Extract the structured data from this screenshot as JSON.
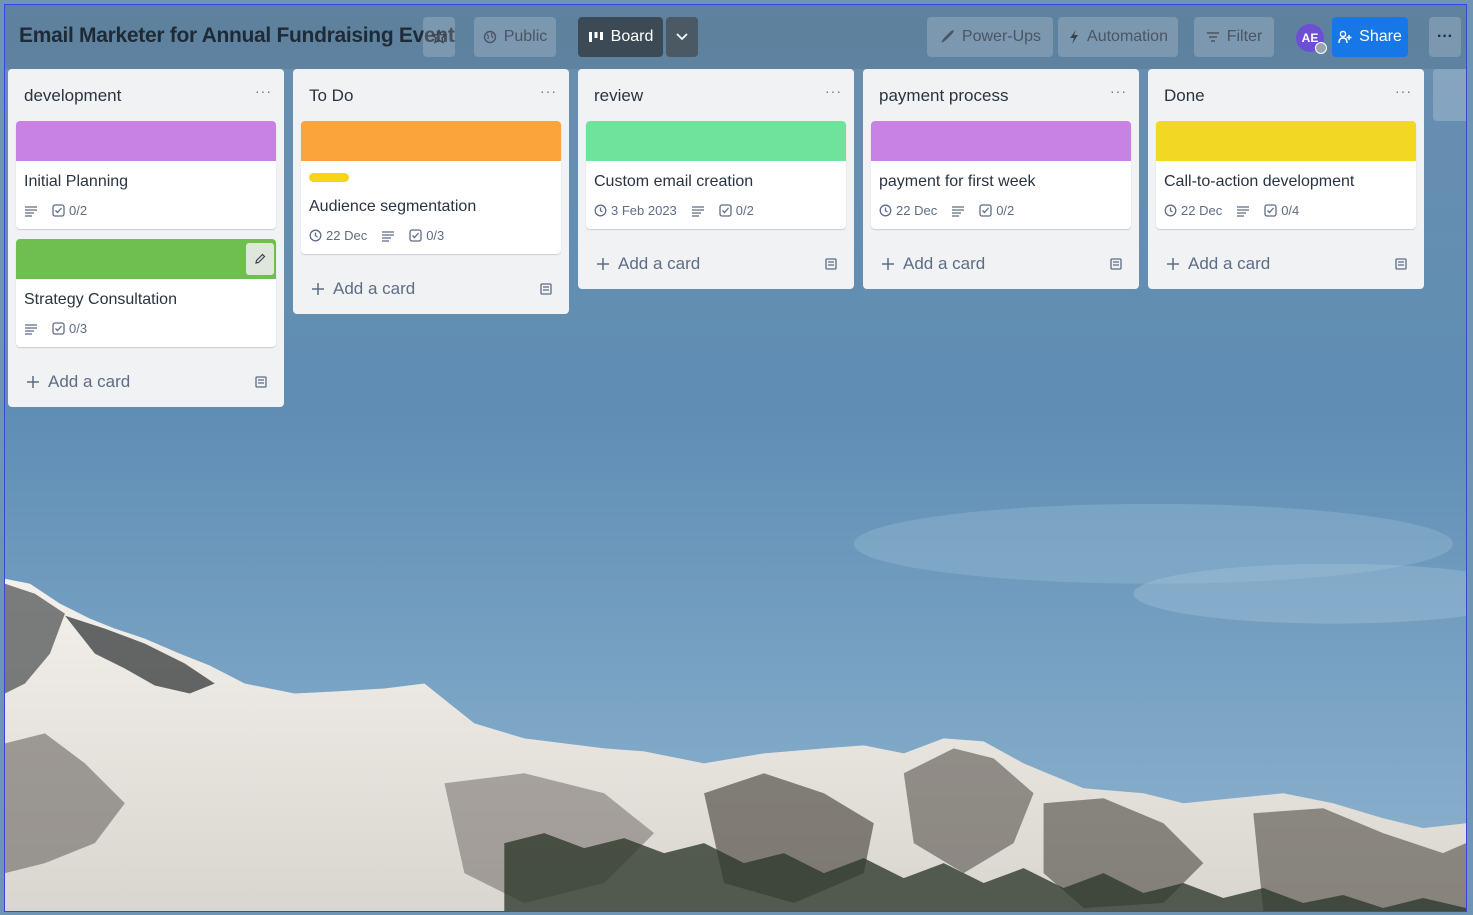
{
  "board": {
    "title": "Email Marketer for Annual Fundraising Event",
    "visibility_label": "Public",
    "view_label": "Board",
    "powerups_label": "Power-Ups",
    "automation_label": "Automation",
    "filter_label": "Filter",
    "avatar_initials": "AE",
    "share_label": "Share",
    "more_label": "···"
  },
  "lists": [
    {
      "title": "development",
      "menu": "···",
      "cards": [
        {
          "title": "Initial Planning",
          "cover": "#c882e4",
          "date": "",
          "checklist": "0/2"
        },
        {
          "title": "Strategy Consultation",
          "cover": "#6ebf4f",
          "date": "",
          "checklist": "0/3"
        }
      ],
      "add_label": "Add a card"
    },
    {
      "title": "To Do",
      "menu": "···",
      "cards": [
        {
          "title": "Audience segmentation",
          "cover": "#fba43b",
          "date": "22 Dec",
          "checklist": "0/3"
        }
      ],
      "add_label": "Add a card"
    },
    {
      "title": "review",
      "menu": "···",
      "cards": [
        {
          "title": "Custom email creation",
          "cover": "#6fe39c",
          "date": "3 Feb 2023",
          "checklist": "0/2"
        }
      ],
      "add_label": "Add a card"
    },
    {
      "title": "payment process",
      "menu": "···",
      "cards": [
        {
          "title": "payment for first week",
          "cover": "#c882e4",
          "date": "22 Dec",
          "checklist": "0/2"
        }
      ],
      "add_label": "Add a card"
    },
    {
      "title": "Done",
      "menu": "···",
      "cards": [
        {
          "title": "Call-to-action development",
          "cover": "#f3d823",
          "date": "22 Dec",
          "checklist": "0/4"
        }
      ],
      "add_label": "Add a card"
    }
  ],
  "colors": {
    "header_dark": "#3b4a55",
    "share_blue": "#1877e6",
    "avatar": "#6d4fd6",
    "label_yellow": "#f4d51b"
  },
  "icons": [
    "star-icon",
    "globe-icon",
    "board-icon",
    "chevron-down-icon",
    "rocket-icon",
    "lightning-icon",
    "filter-icon",
    "share-person-icon",
    "description-icon",
    "checklist-icon",
    "clock-icon",
    "plus-icon",
    "template-icon",
    "pencil-icon"
  ]
}
